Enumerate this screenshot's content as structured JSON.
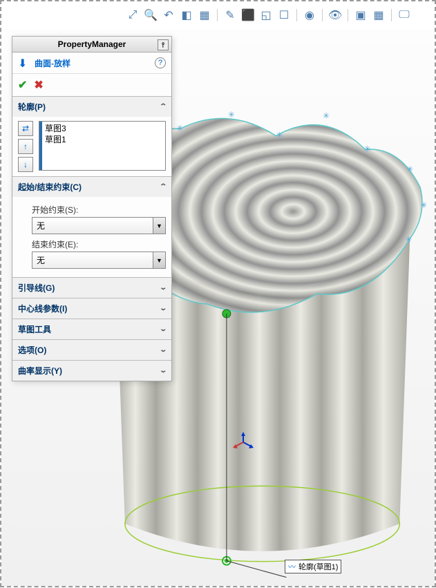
{
  "panel": {
    "title": "PropertyManager",
    "feature_title": "曲面-放样",
    "sections": {
      "profiles": {
        "header": "轮廓(P)",
        "items": [
          "草图3",
          "草图1"
        ]
      },
      "constraints": {
        "header": "起始/结束约束(C)",
        "start_label": "开始约束(S):",
        "start_value": "无",
        "end_label": "结束约束(E):",
        "end_value": "无"
      },
      "guides": {
        "header": "引导线(G)"
      },
      "centerline": {
        "header": "中心线参数(I)"
      },
      "sketch_tools": {
        "header": "草图工具"
      },
      "options": {
        "header": "选项(O)"
      },
      "curvature": {
        "header": "曲率显示(Y)"
      }
    }
  },
  "callout": {
    "label": "轮廓(草图1)"
  },
  "colors": {
    "accent": "#0066cc"
  }
}
